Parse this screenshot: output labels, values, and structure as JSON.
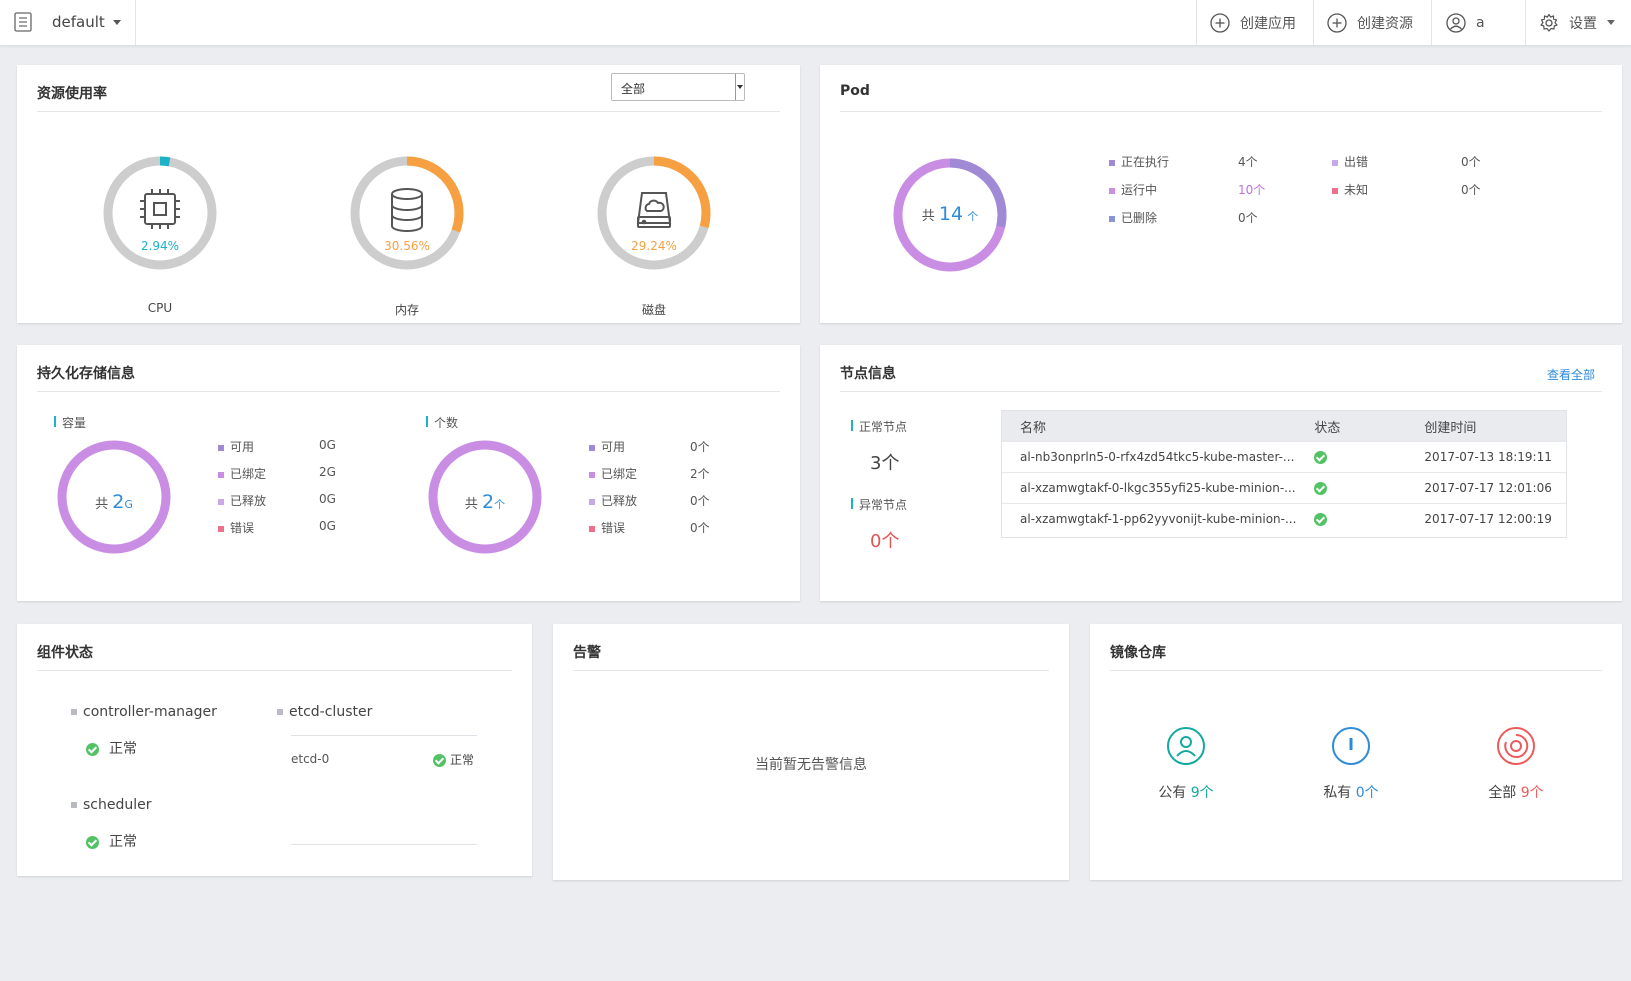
{
  "topbar": {
    "namespace": "default",
    "create_app": "创建应用",
    "create_resource": "创建资源",
    "user": "a",
    "settings": "设置"
  },
  "resource": {
    "title": "资源使用率",
    "filter": "全部",
    "gauges": [
      {
        "label": "CPU",
        "percent_text": "2.94%",
        "value": 2.94,
        "color": "#1ab3c8"
      },
      {
        "label": "内存",
        "percent_text": "30.56%",
        "value": 30.56,
        "color": "#f6a041"
      },
      {
        "label": "磁盘",
        "percent_text": "29.24%",
        "value": 29.24,
        "color": "#f6a041"
      }
    ]
  },
  "pod": {
    "title": "Pod",
    "total_prefix": "共",
    "total": "14",
    "total_unit": "个",
    "legend": [
      {
        "label": "正在执行",
        "value": "4个",
        "color": "#a08ad6"
      },
      {
        "label": "运行中",
        "value": "10个",
        "color": "#c98ee3"
      },
      {
        "label": "已删除",
        "value": "0个",
        "color": "#8a95d8"
      },
      {
        "label": "出错",
        "value": "0个",
        "color": "#c7a8e8"
      },
      {
        "label": "未知",
        "value": "0个",
        "color": "#ec6f8c"
      }
    ]
  },
  "storage": {
    "title": "持久化存储信息",
    "capacity": {
      "heading": "容量",
      "total_prefix": "共",
      "total": "2",
      "unit": "G",
      "legend": [
        {
          "label": "可用",
          "value": "0G",
          "color": "#a08ad6"
        },
        {
          "label": "已绑定",
          "value": "2G",
          "color": "#c98ee3"
        },
        {
          "label": "已释放",
          "value": "0G",
          "color": "#c7a8e8"
        },
        {
          "label": "错误",
          "value": "0G",
          "color": "#ec6f8c"
        }
      ]
    },
    "count": {
      "heading": "个数",
      "total_prefix": "共",
      "total": "2",
      "unit": "个",
      "legend": [
        {
          "label": "可用",
          "value": "0个",
          "color": "#a08ad6"
        },
        {
          "label": "已绑定",
          "value": "2个",
          "color": "#c98ee3"
        },
        {
          "label": "已释放",
          "value": "0个",
          "color": "#c7a8e8"
        },
        {
          "label": "错误",
          "value": "0个",
          "color": "#ec6f8c"
        }
      ]
    }
  },
  "nodes": {
    "title": "节点信息",
    "view_all": "查看全部",
    "normal_label": "正常节点",
    "normal_count": "3个",
    "abnormal_label": "异常节点",
    "abnormal_count": "0个",
    "columns": [
      "名称",
      "状态",
      "创建时间"
    ],
    "rows": [
      {
        "name": "al-nb3onprln5-0-rfx4zd54tkc5-kube-master-...",
        "created": "2017-07-13 18:19:11"
      },
      {
        "name": "al-xzamwgtakf-0-lkgc355yfi25-kube-minion-...",
        "created": "2017-07-17 12:01:06"
      },
      {
        "name": "al-xzamwgtakf-1-pp62yyvonijt-kube-minion-...",
        "created": "2017-07-17 12:00:19"
      }
    ]
  },
  "components": {
    "title": "组件状态",
    "controller_manager": "controller-manager",
    "controller_status": "正常",
    "scheduler": "scheduler",
    "scheduler_status": "正常",
    "etcd_cluster": "etcd-cluster",
    "etcd_member": "etcd-0",
    "etcd_status": "正常"
  },
  "alerts": {
    "title": "告警",
    "empty": "当前暂无告警信息"
  },
  "registry": {
    "title": "镜像仓库",
    "items": [
      {
        "label": "公有",
        "count": "9个",
        "color": "#14a9a0"
      },
      {
        "label": "私有",
        "count": "0个",
        "color": "#2e8bd8"
      },
      {
        "label": "全部",
        "count": "9个",
        "color": "#ec5b5b"
      }
    ]
  }
}
